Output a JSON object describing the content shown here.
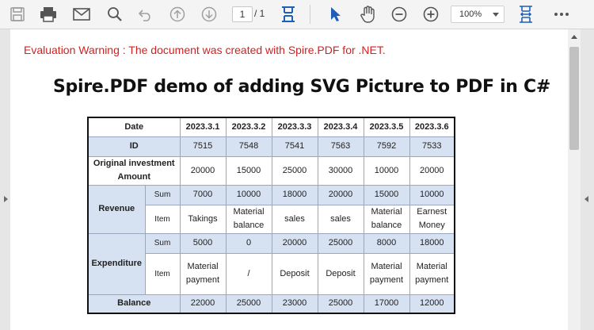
{
  "toolbar": {
    "page_current": "1",
    "page_total": "/ 1",
    "zoom": "100%",
    "icons": [
      "save-icon",
      "print-icon",
      "email-icon",
      "search-icon",
      "undo-icon",
      "page-up-icon",
      "page-down-icon",
      "fit-page-icon",
      "select-cursor-icon",
      "hand-icon",
      "zoom-out-icon",
      "zoom-in-icon",
      "fit-width-icon",
      "more-icon"
    ]
  },
  "colors": {
    "accent": "#1e5fb8",
    "warning": "#d52020",
    "table_header_bg": "#d6e1f2"
  },
  "document": {
    "warning": "Evaluation Warning : The document was created with Spire.PDF for .NET.",
    "title": "Spire.PDF demo of adding SVG Picture to PDF in C#"
  },
  "table": {
    "header": {
      "label": "Date",
      "dates": [
        "2023.3.1",
        "2023.3.2",
        "2023.3.3",
        "2023.3.4",
        "2023.3.5",
        "2023.3.6"
      ]
    },
    "id_row": {
      "label": "ID",
      "values": [
        "7515",
        "7548",
        "7541",
        "7563",
        "7592",
        "7533"
      ]
    },
    "investment_row": {
      "label": "Original investment Amount",
      "values": [
        "20000",
        "15000",
        "25000",
        "30000",
        "10000",
        "20000"
      ]
    },
    "revenue": {
      "label": "Revenue",
      "sum_label": "Sum",
      "sum": [
        "7000",
        "10000",
        "18000",
        "20000",
        "15000",
        "10000"
      ],
      "item_label": "Item",
      "item": [
        "Takings",
        "Material balance",
        "sales",
        "sales",
        "Material balance",
        "Earnest Money"
      ]
    },
    "expenditure": {
      "label": "Expenditure",
      "sum_label": "Sum",
      "sum": [
        "5000",
        "0",
        "20000",
        "25000",
        "8000",
        "18000"
      ],
      "item_label": "Item",
      "item": [
        "Material payment",
        "/",
        "Deposit",
        "Deposit",
        "Material payment",
        "Material payment"
      ]
    },
    "balance_row": {
      "label": "Balance",
      "values": [
        "22000",
        "25000",
        "23000",
        "25000",
        "17000",
        "12000"
      ]
    }
  }
}
